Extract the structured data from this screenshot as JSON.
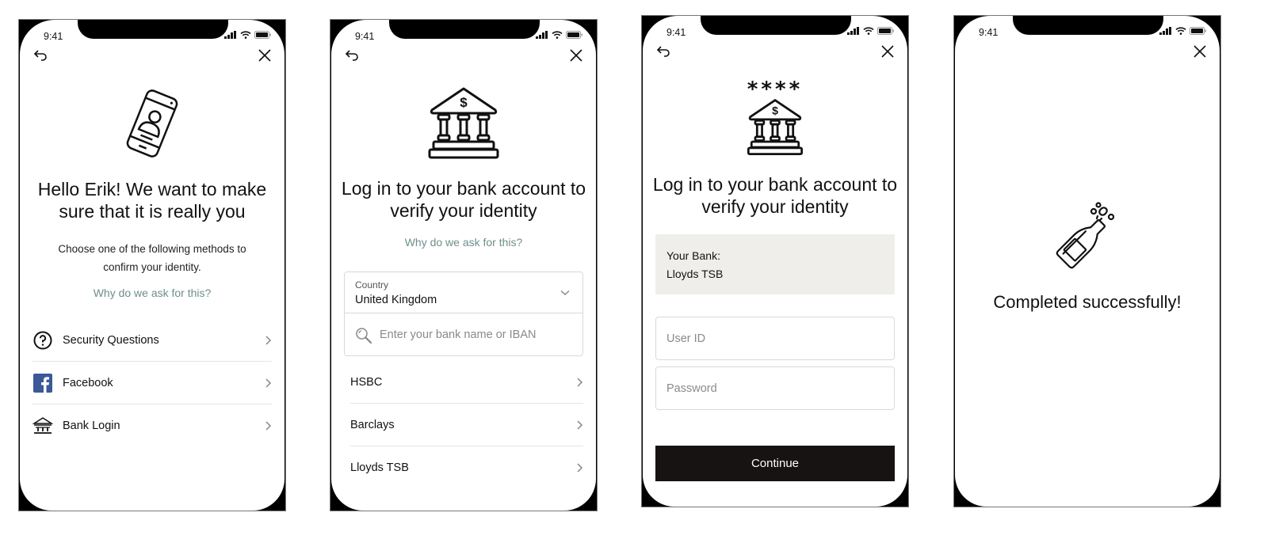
{
  "status_bar": {
    "time": "9:41"
  },
  "screens": [
    {
      "title": "Hello Erik!  We want to make sure that it is really you",
      "subtitle": "Choose one of the following methods to confirm your identity.",
      "why_link": "Why do we ask for this?",
      "methods": [
        {
          "label": "Security Questions",
          "icon": "question-circle-icon"
        },
        {
          "label": "Facebook",
          "icon": "facebook-icon"
        },
        {
          "label": "Bank Login",
          "icon": "bank-icon"
        }
      ]
    },
    {
      "title": "Log in to your bank account to verify your identity",
      "why_link": "Why do we ask for this?",
      "country": {
        "label": "Country",
        "value": "United Kingdom"
      },
      "search": {
        "placeholder": "Enter your bank name or IBAN"
      },
      "banks": [
        {
          "label": "HSBC"
        },
        {
          "label": "Barclays"
        },
        {
          "label": "Lloyds TSB"
        }
      ]
    },
    {
      "title": "Log in to your bank account to verify your identity",
      "hero_mask": "****",
      "bank_card": {
        "label": "Your Bank:",
        "value": "Lloyds TSB"
      },
      "user_id": {
        "placeholder": "User ID",
        "value": ""
      },
      "password": {
        "placeholder": "Password",
        "value": ""
      },
      "continue_label": "Continue"
    },
    {
      "message": "Completed successfully!"
    }
  ],
  "colors": {
    "link": "#6e8f8b",
    "facebook": "#3b5998",
    "button_bg": "#161312",
    "card_bg": "#efeeeb"
  }
}
